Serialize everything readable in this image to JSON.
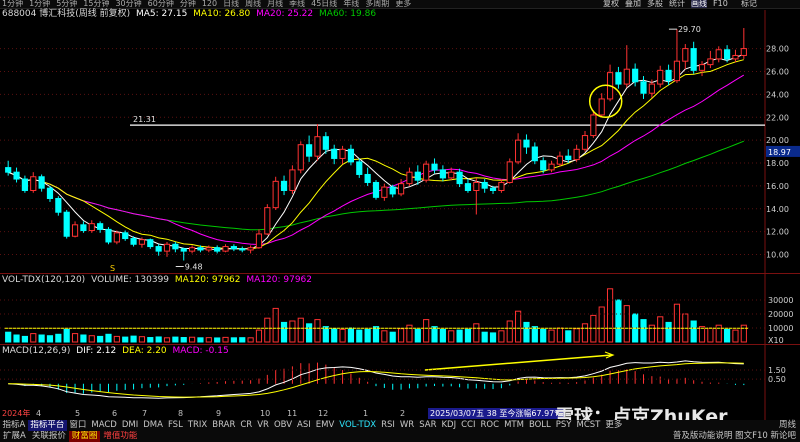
{
  "top_tabs": [
    "1分钟",
    "1分钟",
    "5分钟",
    "15分钟",
    "30分钟",
    "60分钟",
    "分钟",
    "120",
    "日线",
    "周线",
    "月线",
    "季线",
    "45日线",
    "年线",
    "多周期",
    "更多"
  ],
  "top_right_buttons": [
    {
      "label": "复权",
      "active": false
    },
    {
      "label": "叠加",
      "active": false
    },
    {
      "label": "多股",
      "active": false
    },
    {
      "label": "统计",
      "active": false
    },
    {
      "label": "画线",
      "active": true
    },
    {
      "label": "F10",
      "active": false
    },
    {
      "label": "标记",
      "active": false
    }
  ],
  "header": {
    "stock": "688004 博汇科技(周线 前复权)",
    "ma5": "MA5: 27.15",
    "ma10": "MA10: 26.80",
    "ma20": "MA20: 25.22",
    "ma60": "MA60: 19.86"
  },
  "vol_header": {
    "name": "VOL-TDX(120,120)",
    "volume": "VOLUME: 130399",
    "ma120a": "MA120: 97962",
    "ma120b": "MA120: 97962"
  },
  "macd_header": {
    "name": "MACD(12,26,9)",
    "dif": "DIF: 2.12",
    "dea": "DEA: 2.20",
    "macd": "MACD: -0.15"
  },
  "annotations": {
    "hline_label": "21.31",
    "high_label": "29.70",
    "low_label": "9.48",
    "s_marker": "S",
    "last_price": "18.97",
    "date_tooltip": "2025/03/07五 38 至今涨幅67.97%"
  },
  "price_axis": [
    "28.00",
    "26.00",
    "24.00",
    "22.00",
    "20.00",
    "18.00",
    "16.00",
    "14.00",
    "12.00",
    "10.00"
  ],
  "vol_axis": [
    "30000",
    "20000",
    "10000",
    "X10"
  ],
  "macd_axis": [
    "1.50",
    "0.50"
  ],
  "date_labels": [
    "2024年",
    "4",
    "5",
    "6",
    "7",
    "8",
    "9",
    "10",
    "11",
    "12",
    "1",
    "2"
  ],
  "tabs": [
    {
      "label": "指标A",
      "active": false,
      "blue": false
    },
    {
      "label": "指标平台",
      "active": true,
      "blue": false
    },
    {
      "label": "窗口",
      "active": false,
      "blue": false
    },
    {
      "label": "MACD",
      "active": false,
      "blue": false
    },
    {
      "label": "DMI",
      "active": false,
      "blue": false
    },
    {
      "label": "DMA",
      "active": false,
      "blue": false
    },
    {
      "label": "FSL",
      "active": false,
      "blue": false
    },
    {
      "label": "TRIX",
      "active": false,
      "blue": false
    },
    {
      "label": "BRAR",
      "active": false,
      "blue": false
    },
    {
      "label": "CR",
      "active": false,
      "blue": false
    },
    {
      "label": "VR",
      "active": false,
      "blue": false
    },
    {
      "label": "OBV",
      "active": false,
      "blue": false
    },
    {
      "label": "ASI",
      "active": false,
      "blue": false
    },
    {
      "label": "EMV",
      "active": false,
      "blue": false
    },
    {
      "label": "VOL-TDX",
      "active": false,
      "blue": true
    },
    {
      "label": "RSI",
      "active": false,
      "blue": false
    },
    {
      "label": "WR",
      "active": false,
      "blue": false
    },
    {
      "label": "SAR",
      "active": false,
      "blue": false
    },
    {
      "label": "KDJ",
      "active": false,
      "blue": false
    },
    {
      "label": "CCI",
      "active": false,
      "blue": false
    },
    {
      "label": "ROC",
      "active": false,
      "blue": false
    },
    {
      "label": "MTM",
      "active": false,
      "blue": false
    },
    {
      "label": "BOLL",
      "active": false,
      "blue": false
    },
    {
      "label": "PSY",
      "active": false,
      "blue": false
    },
    {
      "label": "MCST",
      "active": false,
      "blue": false
    },
    {
      "label": "更多",
      "active": false,
      "blue": false
    }
  ],
  "tabs_right": "周线",
  "bottom_left": [
    {
      "label": "扩展A",
      "color": "#c8c8c8",
      "bg": ""
    },
    {
      "label": "关联报价",
      "color": "#c8c8c8",
      "bg": ""
    },
    {
      "label": "财富圈",
      "color": "#ffee00",
      "bg": "#7a0000"
    },
    {
      "label": "增值功能",
      "color": "#ff4040",
      "bg": ""
    }
  ],
  "bottom_right": "普及版动能说明 图文F10 新论吧",
  "watermark": "雪球：卢克ZhuKer",
  "colors": {
    "up": "#ff3232",
    "down": "#00ffff",
    "ma5": "#ffffff",
    "ma10": "#ffff00",
    "ma20": "#ff00ff",
    "ma60": "#00c800",
    "vol_ma": "#ffff00"
  },
  "chart_data": {
    "type": "candlestick",
    "title": "688004 博汇科技(周线 前复权)",
    "ylim": [
      9.0,
      30.5
    ],
    "hline": 21.31,
    "candles": [
      [
        17.6,
        17.2,
        18.2,
        16.9
      ],
      [
        17.2,
        16.6,
        17.6,
        16.3
      ],
      [
        16.6,
        15.6,
        16.9,
        15.4
      ],
      [
        15.6,
        16.8,
        17.2,
        15.4
      ],
      [
        16.8,
        15.8,
        17.0,
        15.5
      ],
      [
        15.8,
        14.9,
        16.0,
        14.6
      ],
      [
        14.9,
        13.7,
        15.1,
        13.4
      ],
      [
        13.7,
        11.6,
        13.9,
        11.4
      ],
      [
        11.6,
        12.6,
        12.9,
        11.5
      ],
      [
        12.6,
        12.1,
        12.9,
        11.9
      ],
      [
        12.1,
        12.7,
        13.0,
        11.9
      ],
      [
        12.7,
        12.2,
        12.9,
        11.9
      ],
      [
        12.2,
        11.1,
        12.4,
        10.9
      ],
      [
        11.1,
        11.9,
        12.1,
        10.9
      ],
      [
        11.9,
        11.4,
        12.1,
        11.2
      ],
      [
        11.4,
        10.9,
        11.6,
        10.7
      ],
      [
        10.9,
        11.3,
        11.5,
        10.6
      ],
      [
        11.3,
        10.7,
        11.4,
        10.5
      ],
      [
        10.7,
        10.3,
        10.9,
        9.9
      ],
      [
        10.3,
        10.9,
        11.1,
        9.8
      ],
      [
        10.9,
        10.5,
        11.1,
        10.2
      ],
      [
        10.5,
        10.3,
        10.6,
        9.48
      ],
      [
        10.3,
        10.6,
        10.8,
        10.1
      ],
      [
        10.6,
        10.4,
        10.8,
        10.2
      ],
      [
        10.4,
        10.6,
        10.8,
        10.2
      ],
      [
        10.6,
        10.3,
        10.8,
        10.1
      ],
      [
        10.3,
        10.7,
        10.9,
        10.2
      ],
      [
        10.7,
        10.5,
        10.9,
        10.3
      ],
      [
        10.5,
        10.4,
        10.7,
        10.2
      ],
      [
        10.4,
        10.6,
        10.8,
        10.1
      ],
      [
        10.6,
        11.8,
        12.2,
        10.5
      ],
      [
        11.8,
        14.1,
        14.4,
        11.7
      ],
      [
        14.1,
        16.4,
        16.8,
        13.9
      ],
      [
        16.4,
        15.6,
        16.9,
        15.2
      ],
      [
        15.6,
        17.4,
        17.8,
        15.3
      ],
      [
        17.4,
        19.6,
        19.9,
        17.1
      ],
      [
        19.6,
        18.6,
        20.4,
        18.1
      ],
      [
        18.6,
        20.3,
        21.4,
        18.2
      ],
      [
        20.3,
        19.2,
        20.7,
        18.8
      ],
      [
        19.2,
        18.4,
        19.6,
        17.9
      ],
      [
        18.4,
        19.2,
        19.5,
        17.9
      ],
      [
        19.2,
        18.1,
        19.6,
        17.8
      ],
      [
        18.1,
        17.0,
        18.4,
        16.7
      ],
      [
        17.0,
        16.3,
        17.6,
        16.0
      ],
      [
        16.3,
        15.0,
        16.5,
        14.8
      ],
      [
        15.0,
        15.9,
        16.2,
        14.7
      ],
      [
        15.9,
        15.3,
        16.1,
        15.0
      ],
      [
        15.3,
        16.2,
        16.6,
        15.1
      ],
      [
        16.2,
        17.2,
        17.6,
        16.0
      ],
      [
        17.2,
        16.5,
        17.8,
        16.1
      ],
      [
        16.5,
        17.9,
        18.2,
        16.3
      ],
      [
        17.9,
        17.4,
        18.4,
        17.1
      ],
      [
        17.4,
        16.7,
        17.8,
        16.4
      ],
      [
        16.7,
        17.2,
        17.6,
        16.5
      ],
      [
        17.2,
        16.2,
        17.5,
        15.9
      ],
      [
        16.2,
        15.6,
        16.6,
        15.4
      ],
      [
        15.6,
        16.3,
        16.7,
        13.5
      ],
      [
        16.3,
        15.8,
        16.6,
        15.4
      ],
      [
        15.8,
        15.6,
        16.0,
        15.3
      ],
      [
        15.6,
        16.3,
        16.6,
        15.4
      ],
      [
        16.3,
        18.1,
        18.4,
        16.2
      ],
      [
        18.1,
        20.0,
        20.6,
        17.9
      ],
      [
        20.0,
        19.4,
        20.5,
        18.8
      ],
      [
        19.4,
        18.2,
        19.8,
        17.9
      ],
      [
        18.2,
        17.4,
        18.5,
        17.1
      ],
      [
        17.4,
        17.9,
        18.2,
        17.2
      ],
      [
        17.9,
        18.6,
        19.0,
        17.7
      ],
      [
        18.6,
        18.3,
        19.2,
        18.0
      ],
      [
        18.3,
        19.2,
        19.6,
        18.1
      ],
      [
        19.2,
        20.4,
        20.8,
        19.0
      ],
      [
        20.4,
        22.2,
        22.6,
        20.2
      ],
      [
        22.2,
        23.6,
        24.1,
        22.0
      ],
      [
        23.6,
        25.9,
        26.6,
        23.4
      ],
      [
        25.9,
        24.9,
        26.4,
        24.5
      ],
      [
        24.9,
        26.2,
        28.3,
        24.6
      ],
      [
        26.2,
        25.1,
        26.7,
        24.7
      ],
      [
        25.1,
        24.1,
        25.6,
        23.6
      ],
      [
        24.1,
        24.9,
        25.3,
        23.7
      ],
      [
        24.9,
        26.1,
        26.5,
        24.6
      ],
      [
        26.1,
        25.2,
        26.6,
        24.8
      ],
      [
        25.2,
        26.9,
        29.7,
        25.0
      ],
      [
        26.9,
        28.0,
        28.4,
        26.2
      ],
      [
        28.0,
        26.1,
        28.6,
        25.8
      ],
      [
        26.1,
        26.6,
        26.9,
        25.6
      ],
      [
        26.6,
        27.1,
        27.8,
        26.3
      ],
      [
        27.1,
        27.9,
        28.2,
        26.8
      ],
      [
        27.9,
        27.1,
        28.3,
        26.8
      ],
      [
        27.1,
        27.4,
        27.9,
        26.8
      ],
      [
        27.4,
        28.0,
        29.8,
        27.1
      ]
    ],
    "volume_ylim": [
      0,
      40000
    ],
    "volumes": [
      7000,
      5000,
      4000,
      6000,
      5000,
      4500,
      5500,
      9000,
      6000,
      5000,
      4500,
      4000,
      5500,
      4000,
      3500,
      4200,
      3800,
      3200,
      3600,
      3000,
      3500,
      3200,
      3400,
      3000,
      3100,
      2900,
      3300,
      3000,
      3100,
      3000,
      8500,
      17000,
      24000,
      14000,
      15000,
      17000,
      13000,
      16000,
      11000,
      9500,
      9000,
      10000,
      8500,
      9000,
      11000,
      8000,
      7000,
      9500,
      12000,
      9000,
      16000,
      11000,
      9000,
      8000,
      8500,
      9000,
      13000,
      7000,
      6500,
      8000,
      15000,
      22000,
      14000,
      11000,
      9000,
      8500,
      10000,
      8000,
      9500,
      13000,
      19000,
      25000,
      38000,
      30000,
      26000,
      20000,
      16000,
      12000,
      18000,
      14000,
      27000,
      20000,
      15000,
      11000,
      10000,
      12000,
      9000,
      8500,
      12000
    ],
    "volume_ma120": 9796
  }
}
